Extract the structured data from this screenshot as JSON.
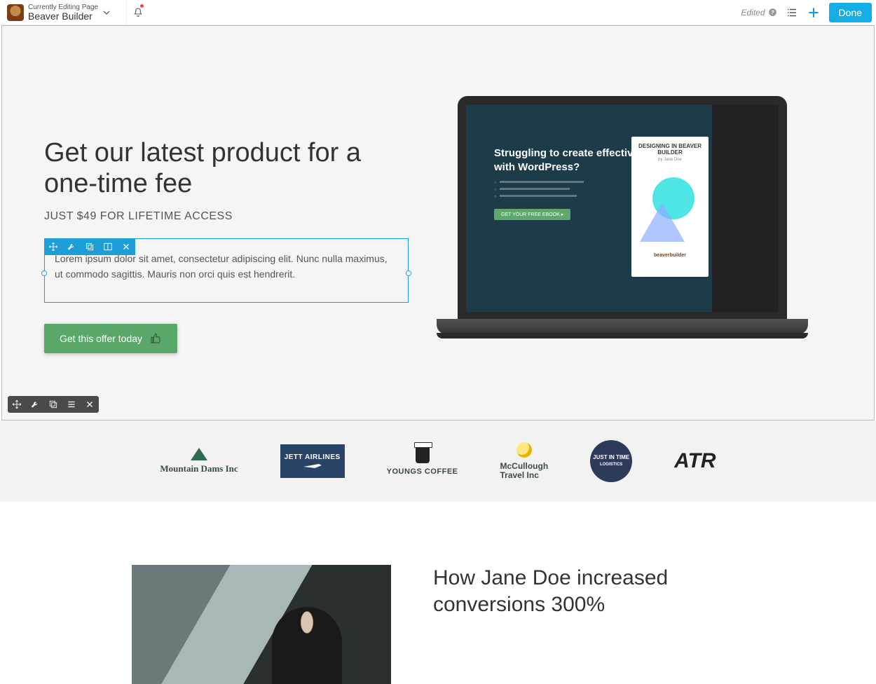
{
  "topbar": {
    "editing_label": "Currently Editing Page",
    "page_title": "Beaver Builder",
    "edited_label": "Edited",
    "done_label": "Done"
  },
  "hero": {
    "heading": "Get our latest product for a one-time fee",
    "subheading": "JUST $49 FOR LIFETIME ACCESS",
    "paragraph": "Lorem ipsum dolor sit amet, consectetur adipiscing elit. Nunc nulla maximus, ut commodo sagittis. Mauris non orci quis est hendrerit.",
    "cta_label": "Get this offer today"
  },
  "laptop": {
    "headline": "Struggling to create effective designs with WordPress?",
    "card_title": "DESIGNING IN BEAVER BUILDER",
    "card_byline": "by Jane Doe",
    "card_logo": "beaverbuilder"
  },
  "logos": {
    "mountain": "Mountain Dams Inc",
    "jett": "JETT AIRLINES",
    "youngs": "YOUNGS COFFEE",
    "mcc_top": "McCullough",
    "mcc_bot": "Travel Inc",
    "jit": "JUST IN TIME",
    "jit2": "LOGISTICS",
    "atr": "ATR"
  },
  "testimonial": {
    "heading": "How Jane Doe increased conversions 300%"
  }
}
